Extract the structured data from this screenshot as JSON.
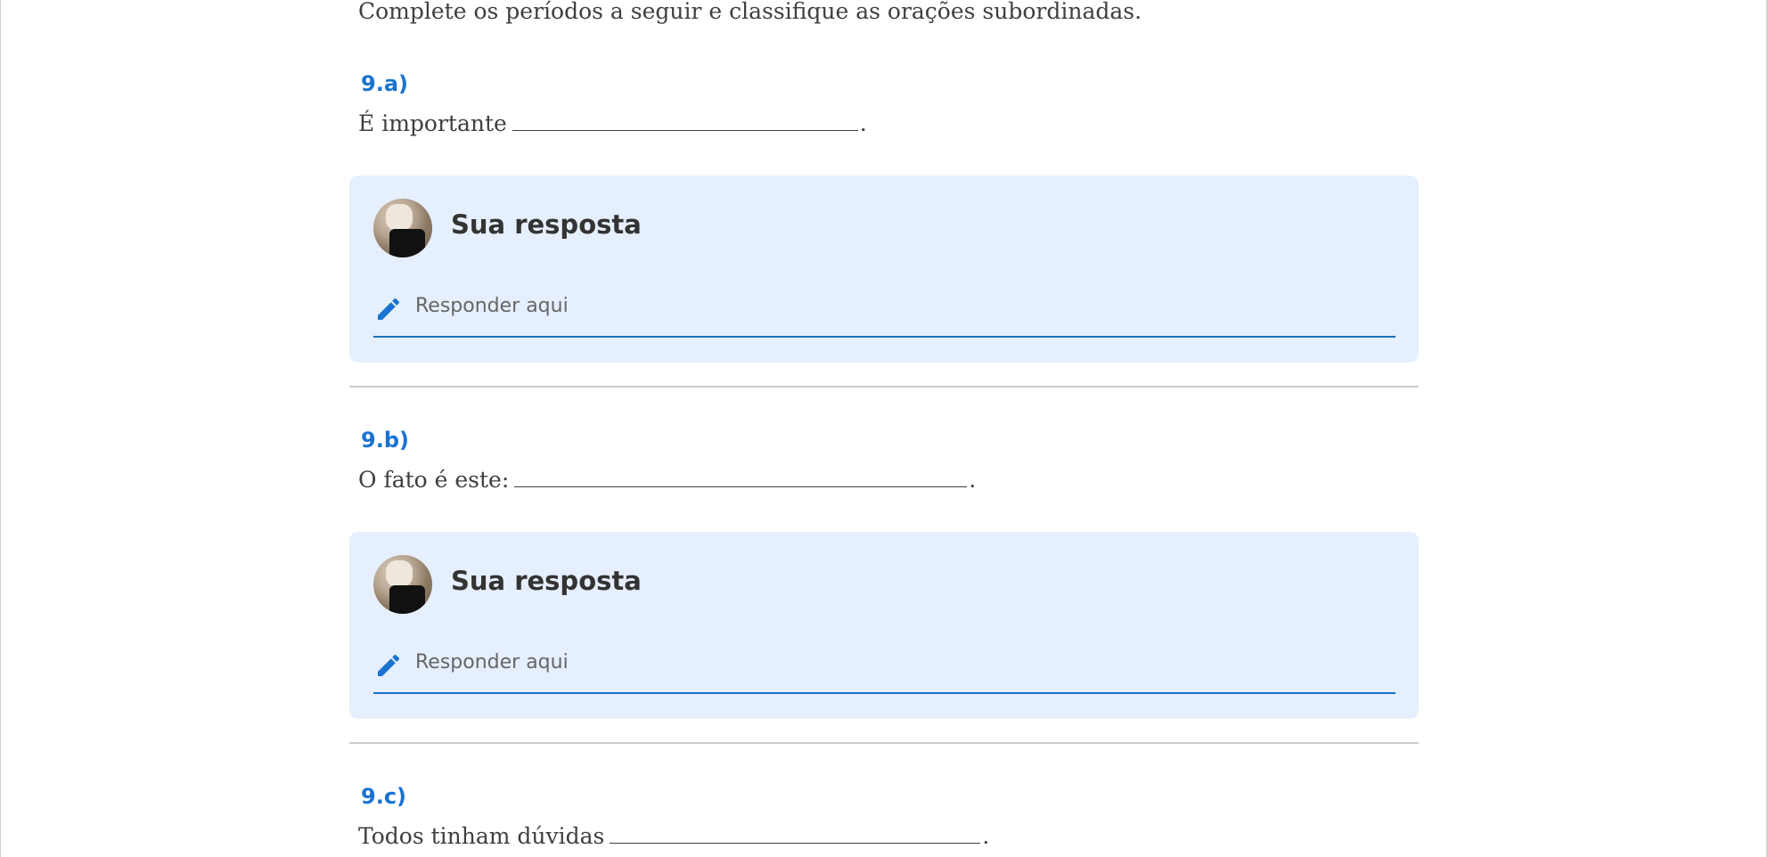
{
  "intro": "Complete os períodos a seguir e classifique as orações subordinadas.",
  "questions": [
    {
      "label": "9.a)",
      "text_before": "É importante",
      "text_after": ".",
      "answer": {
        "title": "Sua resposta",
        "placeholder": "Responder aqui"
      }
    },
    {
      "label": "9.b)",
      "text_before": "O fato é este:",
      "text_after": ".",
      "answer": {
        "title": "Sua resposta",
        "placeholder": "Responder aqui"
      }
    },
    {
      "label": "9.c)",
      "text_before": "Todos tinham dúvidas",
      "text_after": "."
    }
  ],
  "icons": {
    "pencil": "pencil-icon",
    "avatar": "user-avatar"
  },
  "colors": {
    "accent": "#1a73d0",
    "card_background": "#e6effd",
    "input_underline": "#1a6fc4"
  }
}
